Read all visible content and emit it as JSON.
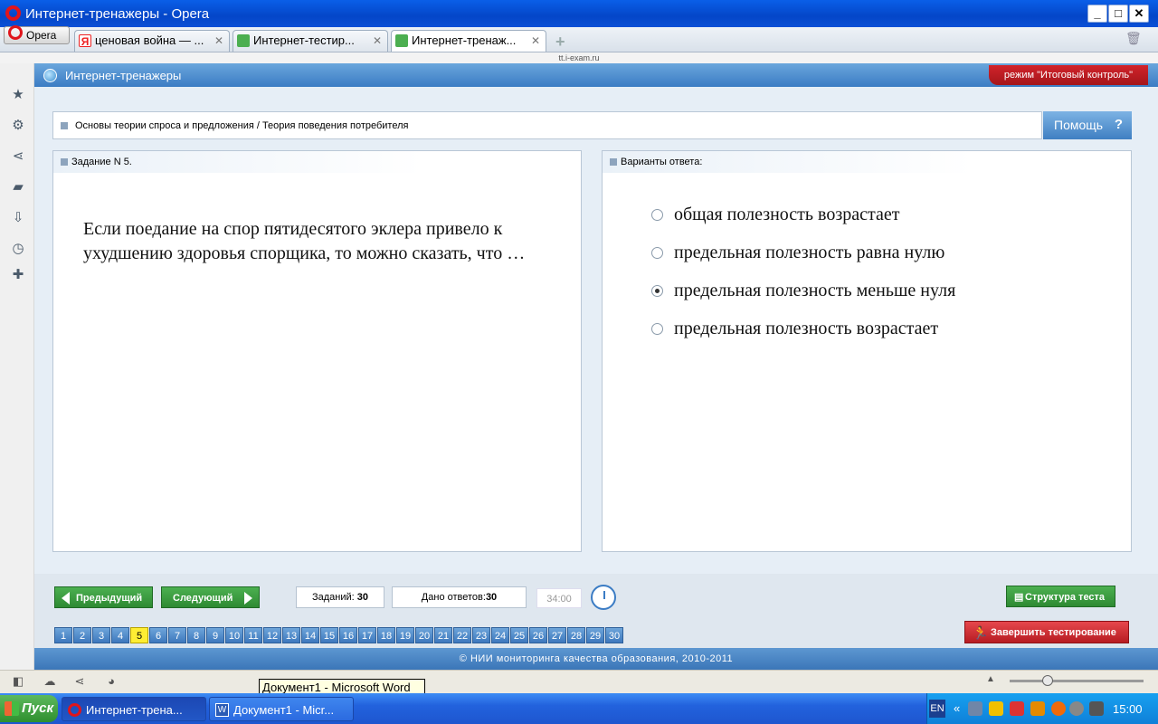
{
  "window": {
    "title": "Интернет-тренажеры - Opera"
  },
  "browser": {
    "menu_label": "Opera",
    "tabs": [
      {
        "label": "ценовая война — ..."
      },
      {
        "label": "Интернет-тестир..."
      },
      {
        "label": "Интернет-тренаж..."
      }
    ],
    "url": "tt.i-exam.ru"
  },
  "page": {
    "title": "Интернет-тренажеры",
    "mode": "режим \"Итоговый контроль\"",
    "breadcrumb": "Основы теории спроса и предложения / Теория поведения потребителя",
    "help_label": "Помощь",
    "help_icon": "?",
    "task_header": "Задание N 5.",
    "question": "Если поедание на спор пятидесятого эклера привело к ухудшению здоровья спорщика, то можно сказать, что …",
    "answers_header": "Варианты ответа:",
    "options": [
      {
        "label": "общая полезность возрастает",
        "selected": false
      },
      {
        "label": "предельная полезность равна нулю",
        "selected": false
      },
      {
        "label": "предельная полезность меньше нуля",
        "selected": true
      },
      {
        "label": "предельная полезность возрастает",
        "selected": false
      }
    ],
    "prev_label": "Предыдущий",
    "next_label": "Следующий",
    "tasks_label": "Заданий:",
    "tasks_count": "30",
    "answers_label": "Дано ответов:",
    "answers_count": "30",
    "timer": "34:00",
    "structure_label": "Структура теста",
    "finish_label": "Завершить тестирование",
    "current_question": 5,
    "question_numbers": [
      "1",
      "2",
      "3",
      "4",
      "5",
      "6",
      "7",
      "8",
      "9",
      "10",
      "11",
      "12",
      "13",
      "14",
      "15",
      "16",
      "17",
      "18",
      "19",
      "20",
      "21",
      "22",
      "23",
      "24",
      "25",
      "26",
      "27",
      "28",
      "29",
      "30"
    ],
    "footer": "© НИИ мониторинга качества образования, 2010-2011"
  },
  "statusbar": {
    "tooltip": "Документ1 - Microsoft Word"
  },
  "taskbar": {
    "start_label": "Пуск",
    "tasks": [
      {
        "label": "Интернет-трена..."
      },
      {
        "label": "Документ1 - Micr..."
      }
    ],
    "lang": "EN",
    "clock": "15:00"
  },
  "colors": {
    "accent": "#3b7cc4",
    "mode_red": "#c3202a",
    "green_button": "#3a9c3f",
    "current_q": "#ffee33"
  }
}
